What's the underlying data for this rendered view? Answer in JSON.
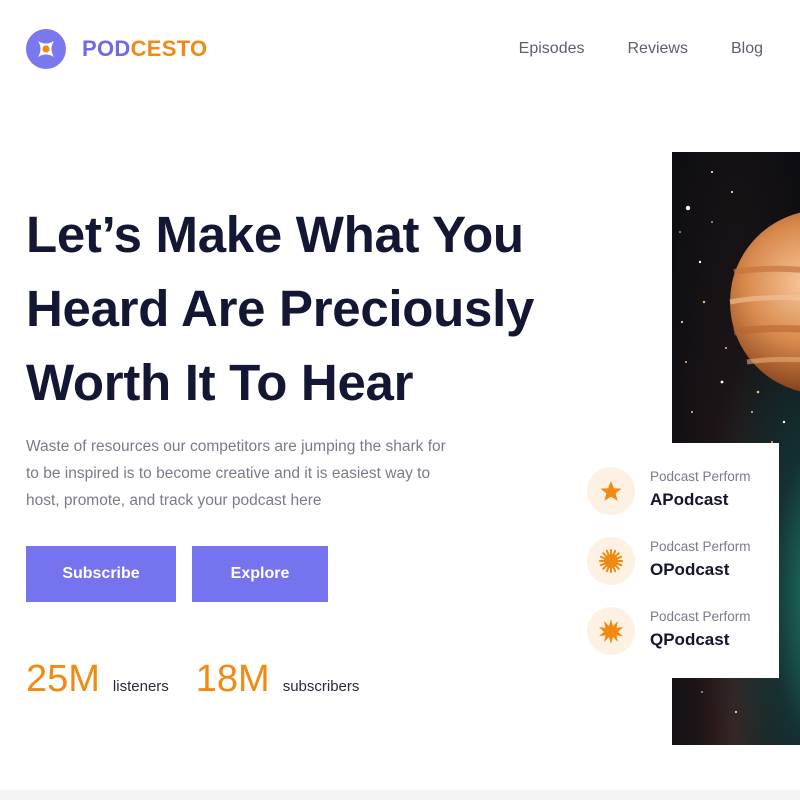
{
  "brand": {
    "name_part1": "POD",
    "name_part2": "CESTO",
    "color_primary": "#6e6ae8",
    "color_accent": "#f08a12",
    "logo_icon": "sparkle-icon"
  },
  "nav": {
    "items": [
      {
        "label": "Episodes"
      },
      {
        "label": "Reviews"
      },
      {
        "label": "Blog"
      }
    ]
  },
  "hero": {
    "title_lines": [
      "Let’s Make What You",
      "Heard Are Preciously",
      "Worth It To Hear"
    ],
    "description": "Waste of resources our competitors are jumping the shark for to be inspired is to become creative and it is easiest way to host, promote, and track your podcast here",
    "subscribe_label": "Subscribe",
    "explore_label": "Explore",
    "button_color": "#7573ee"
  },
  "stats": [
    {
      "value": "25M",
      "label": "listeners"
    },
    {
      "value": "18M",
      "label": "subscribers"
    }
  ],
  "podcasts": [
    {
      "subtitle": "Podcast Perform",
      "name": "APodcast",
      "icon": "star-icon"
    },
    {
      "subtitle": "Podcast Perform",
      "name": "OPodcast",
      "icon": "sun-burst-icon"
    },
    {
      "subtitle": "Podcast Perform",
      "name": "QPodcast",
      "icon": "spiky-burst-icon"
    }
  ],
  "hero_image": {
    "subject": "planet-in-space-image"
  }
}
